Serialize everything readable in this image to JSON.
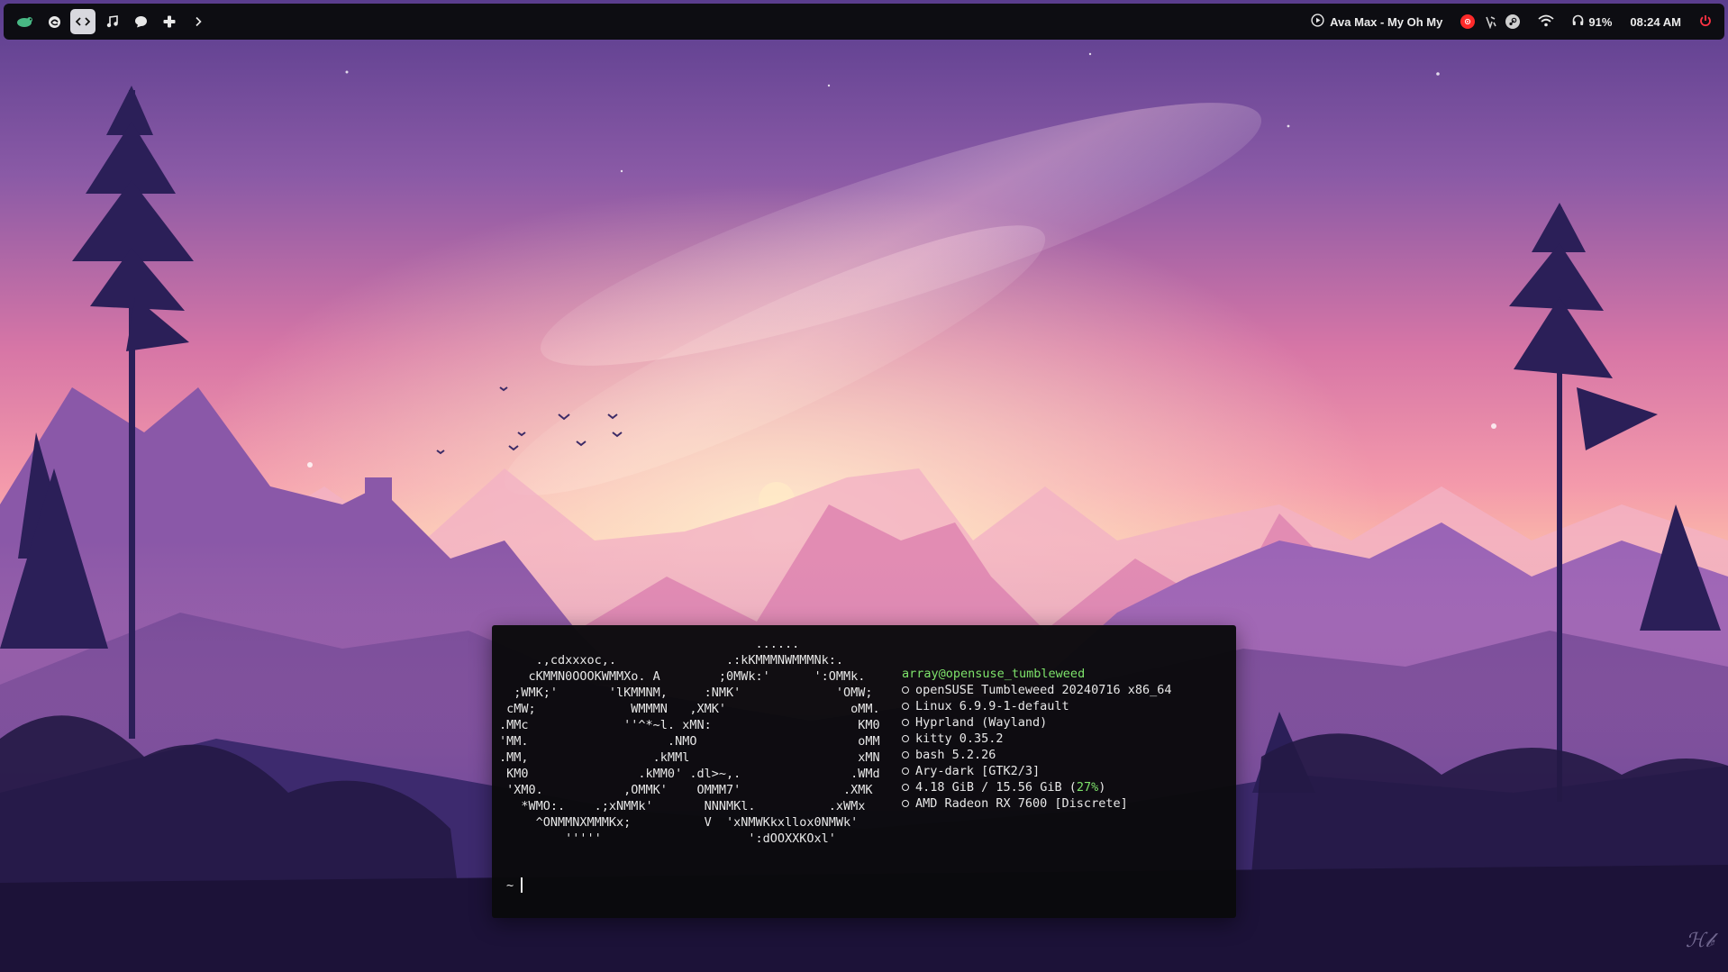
{
  "topbar": {
    "workspaces": [
      {
        "icon": "opensuse-gecko-icon",
        "active": false
      },
      {
        "icon": "browser-icon",
        "active": false
      },
      {
        "icon": "code-icon",
        "active": true
      },
      {
        "icon": "music-note-icon",
        "active": false
      },
      {
        "icon": "chat-bubble-icon",
        "active": false
      },
      {
        "icon": "game-controller-icon",
        "active": false
      }
    ],
    "expand_icon": "chevron-right-icon",
    "media": {
      "icon": "play-circle-icon",
      "title": "Ava Max - My Oh My"
    },
    "tray": [
      {
        "icon": "youtube-music-icon",
        "color": "#ff2a2a"
      },
      {
        "icon": "vesktop-icon",
        "color": "#cfcfcf"
      },
      {
        "icon": "steam-icon",
        "color": "#cfcfcf"
      }
    ],
    "wifi_icon": "wifi-icon",
    "headset": {
      "icon": "headphones-icon",
      "level": "91%"
    },
    "clock": "08:24 AM",
    "power": {
      "icon": "power-icon",
      "color": "#ff3344"
    }
  },
  "terminal": {
    "ascii_art": [
      "                                   ......",
      "     .,cdxxxoc,.               .:kKMMMNWMMMNk:.",
      "    cKMMN0OOOKWMMXo. A        ;0MWk:'      ':OMMk.",
      "  ;WMK;'       'lKMMNM,     :NMK'             'OMW;",
      " cMW;             WMMMN   ,XMK'                 oMM.",
      ".MMc             ''^*~l. xMN:                    KM0",
      "'MM.                   .NMO                      oMM",
      ".MM,                 .kMMl                       xMN",
      " KM0               .kMM0' .dl>~,.               .WMd",
      " 'XM0.           ,OMMK'    OMMM7'              .XMK",
      "   *WMO:.    .;xNMMk'       NNNMKl.          .xWMx",
      "     ^ONMMNXMMMKx;          V  'xNMWKkxllox0NMWk'",
      "         '''''                    ':dOOXXKOxl'"
    ],
    "user_host": "array@opensuse_tumbleweed",
    "info": [
      "openSUSE Tumbleweed 20240716 x86_64",
      "Linux 6.9.9-1-default",
      "Hyprland (Wayland)",
      "kitty 0.35.2",
      "bash 5.2.26",
      "Ary-dark [GTK2/3]"
    ],
    "memory": {
      "used": "4.18 GiB",
      "total": "15.56 GiB",
      "percent": "27%"
    },
    "gpu": "AMD Radeon RX 7600 [Discrete]",
    "prompt_symbol": "~"
  },
  "colors": {
    "accent_green": "#7ee36b",
    "bar_bg": "#0d0d12",
    "terminal_bg": "#0a0a0c"
  }
}
